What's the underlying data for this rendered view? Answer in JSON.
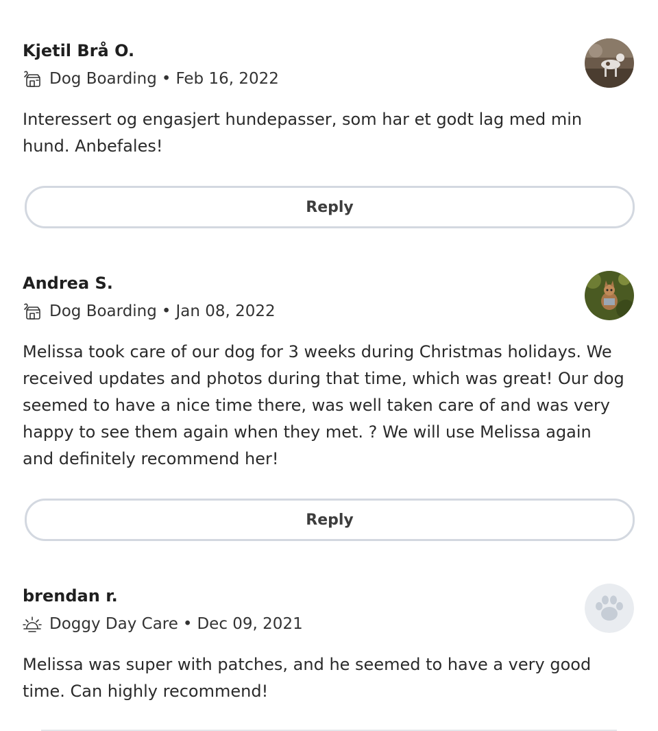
{
  "reviews": [
    {
      "name": "Kjetil Brå O.",
      "service": "Dog Boarding",
      "separator": "•",
      "date": "Feb 16, 2022",
      "service_icon": "dog-boarding-icon",
      "text": "Interessert og engasjert hundepasser, som har et godt lag med min hund. Anbefales!",
      "reply_label": "Reply"
    },
    {
      "name": "Andrea S.",
      "service": "Dog Boarding",
      "separator": "•",
      "date": "Jan 08, 2022",
      "service_icon": "dog-boarding-icon",
      "text": "Melissa took care of our dog for 3 weeks during Christmas holidays. We received updates and photos during that time, which was great! Our dog seemed to have a nice time there, was well taken care of and was very happy to see them again when they met. ? We will use Melissa again and definitely recommend her!",
      "reply_label": "Reply"
    },
    {
      "name": "brendan r.",
      "service": "Doggy Day Care",
      "separator": "•",
      "date": "Dec 09, 2021",
      "service_icon": "sun-icon",
      "text": "Melissa was super with patches, and he seemed to have a very good time. Can highly recommend!"
    }
  ],
  "colors": {
    "button_border": "#d3d8e0",
    "placeholder_avatar_bg": "#e9ecf0",
    "placeholder_paw": "#c6cdd6"
  }
}
